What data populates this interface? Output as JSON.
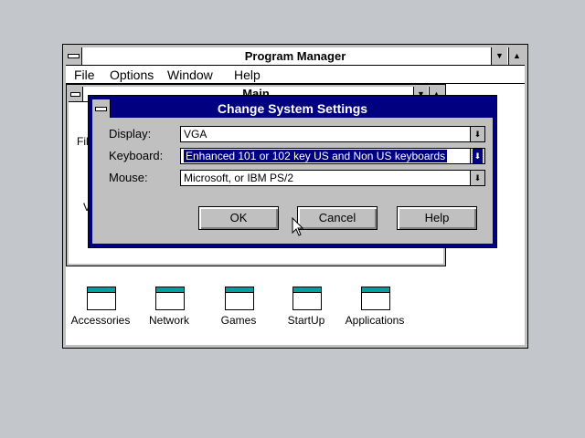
{
  "program_manager": {
    "title": "Program Manager",
    "menu": [
      "File",
      "Options",
      "Window",
      "Help"
    ]
  },
  "main_window": {
    "title": "Main",
    "partial_left_text": "Fil"
  },
  "dialog": {
    "title": "Change System Settings",
    "fields": [
      {
        "label": "Display:",
        "value": "VGA"
      },
      {
        "label": "Keyboard:",
        "value": "Enhanced 101 or 102 key US and Non US keyboards"
      },
      {
        "label": "Mouse:",
        "value": "Microsoft, or IBM PS/2"
      }
    ],
    "buttons": {
      "ok": "OK",
      "cancel": "Cancel",
      "help": "Help"
    }
  },
  "group_icons": [
    "Accessories",
    "Network",
    "Games",
    "StartUp",
    "Applications"
  ],
  "colors": {
    "desktop": "#c3c7cb",
    "dialog_title": "#000080",
    "selection": "#000080"
  }
}
